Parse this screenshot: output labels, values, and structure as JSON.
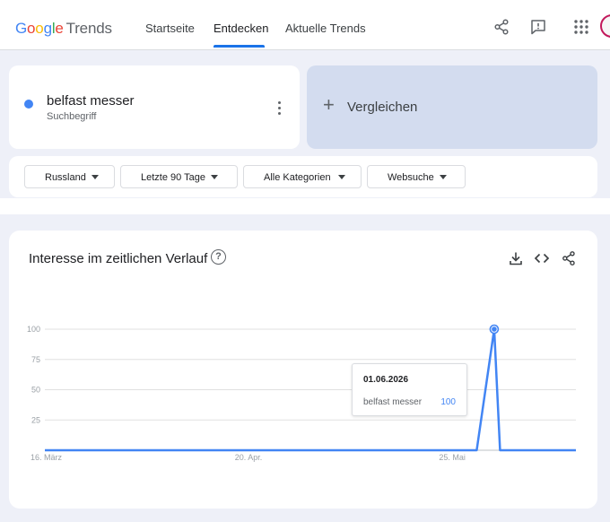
{
  "header": {
    "logo_google": "Google",
    "logo_trends": "Trends",
    "nav": [
      {
        "label": "Startseite",
        "active": false
      },
      {
        "label": "Entdecken",
        "active": true
      },
      {
        "label": "Aktuelle Trends",
        "active": false
      }
    ],
    "icons": [
      "share-icon",
      "feedback-icon",
      "apps-grid-icon",
      "account-avatar"
    ]
  },
  "search_term": {
    "name": "belfast messer",
    "subtitle": "Suchbegriff",
    "color": "#4285f4"
  },
  "compare": {
    "plus": "+",
    "label": "Vergleichen"
  },
  "filters": [
    {
      "label": "Russland"
    },
    {
      "label": "Letzte 90 Tage"
    },
    {
      "label": "Alle Kategorien"
    },
    {
      "label": "Websuche"
    }
  ],
  "chart_section": {
    "title": "Interesse im zeitlichen Verlauf",
    "help": "?",
    "icons": [
      "download-icon",
      "embed-code-icon",
      "share-icon"
    ]
  },
  "tooltip": {
    "date": "01.06.2026",
    "term": "belfast messer",
    "value": "100"
  },
  "chart_data": {
    "type": "line",
    "ylim": [
      0,
      100
    ],
    "yticks": [
      25,
      50,
      75,
      100
    ],
    "xtick_labels": [
      "16. März",
      "20. Apr.",
      "25. Mai"
    ],
    "x_start": "16. März",
    "x_end": "15. Juni",
    "series": [
      {
        "name": "belfast messer",
        "color": "#4285f4",
        "points": [
          {
            "x": "16. März",
            "y": 0
          },
          {
            "x": "29. Mai",
            "y": 0
          },
          {
            "x": "01. Juni",
            "y": 100
          },
          {
            "x": "02. Juni",
            "y": 0
          },
          {
            "x": "15. Juni",
            "y": 0
          }
        ]
      }
    ],
    "grid": true
  }
}
